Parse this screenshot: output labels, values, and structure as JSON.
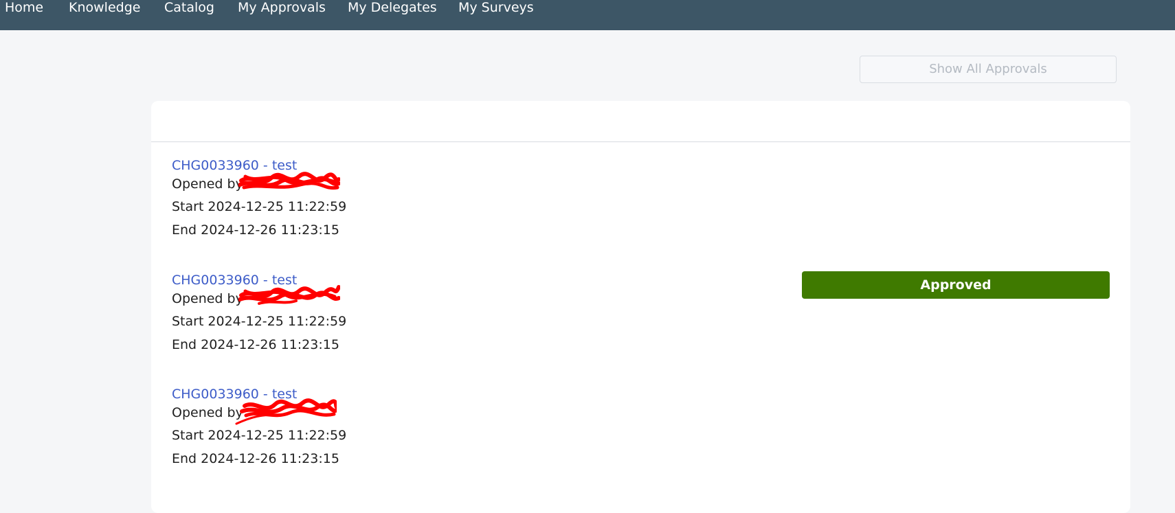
{
  "nav": {
    "items": [
      {
        "label": "Home"
      },
      {
        "label": "Knowledge"
      },
      {
        "label": "Catalog"
      },
      {
        "label": "My Approvals"
      },
      {
        "label": "My Delegates"
      },
      {
        "label": "My Surveys"
      }
    ]
  },
  "toolbar": {
    "show_all_label": "Show All Approvals"
  },
  "approvals": [
    {
      "title": "CHG0033960 - test",
      "opened_by_label": "Opened by",
      "start_label": "Start",
      "start": "2024-12-25 11:22:59",
      "end_label": "End",
      "end": "2024-12-26 11:23:15"
    },
    {
      "title": "CHG0033960 - test",
      "opened_by_label": "Opened by",
      "start_label": "Start",
      "start": "2024-12-25 11:22:59",
      "end_label": "End",
      "end": "2024-12-26 11:23:15",
      "status": "Approved"
    },
    {
      "title": "CHG0033960 - test",
      "opened_by_label": "Opened by",
      "start_label": "Start",
      "start": "2024-12-25 11:22:59",
      "end_label": "End",
      "end": "2024-12-26 11:23:15"
    }
  ],
  "colors": {
    "nav_bg": "#3d5666",
    "link": "#3d5cc8",
    "approved": "#3f7a00",
    "redaction": "#ff0000"
  }
}
